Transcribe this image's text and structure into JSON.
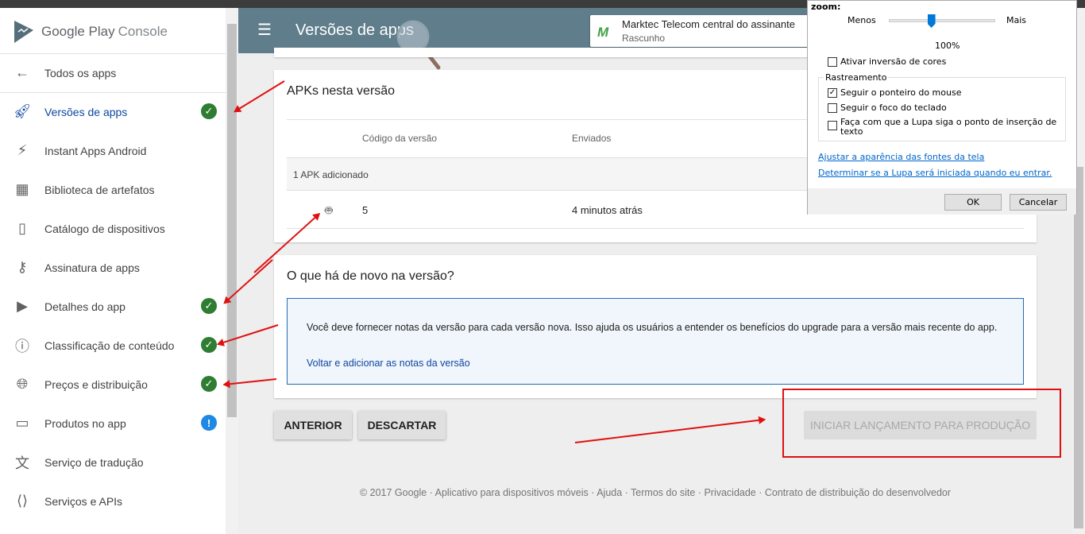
{
  "sidebar": {
    "logo": "Google Play",
    "logo_suffix": "Console",
    "items": [
      {
        "label": "Todos os apps",
        "icon": "arrow-left-icon"
      },
      {
        "label": "Versões de apps",
        "icon": "rocket-icon",
        "status": "check"
      },
      {
        "label": "Instant Apps Android",
        "icon": "bolt-icon"
      },
      {
        "label": "Biblioteca de artefatos",
        "icon": "library-icon"
      },
      {
        "label": "Catálogo de dispositivos",
        "icon": "device-icon"
      },
      {
        "label": "Assinatura de apps",
        "icon": "key-icon"
      },
      {
        "label": "Detalhes do app",
        "icon": "store-icon",
        "status": "check"
      },
      {
        "label": "Classificação de conteúdo",
        "icon": "rating-icon",
        "status": "check"
      },
      {
        "label": "Preços e distribuição",
        "icon": "globe-icon",
        "status": "check"
      },
      {
        "label": "Produtos no app",
        "icon": "card-icon",
        "status": "warning"
      },
      {
        "label": "Serviço de tradução",
        "icon": "translate-icon"
      },
      {
        "label": "Serviços e APIs",
        "icon": "api-icon"
      }
    ]
  },
  "header": {
    "title": "Versões de apps",
    "app_name": "Marktec Telecom central do assinante",
    "app_status": "Rascunho"
  },
  "apks": {
    "title": "APKs nesta versão",
    "col_code": "Código da versão",
    "col_sent": "Enviados",
    "group": "1 APK adicionado",
    "rows": [
      {
        "code": "5",
        "sent": "4 minutos atrás"
      }
    ]
  },
  "whatsnew": {
    "title": "O que há de novo na versão?",
    "message": "Você deve fornecer notas da versão para cada versão nova. Isso ajuda os usuários a entender os benefícios do upgrade para a versão mais recente do app.",
    "link": "Voltar e adicionar as notas da versão"
  },
  "actions": {
    "previous": "ANTERIOR",
    "discard": "DESCARTAR",
    "launch": "INICIAR LANÇAMENTO PARA PRODUÇÃO"
  },
  "footer": "© 2017 Google · Aplicativo para dispositivos móveis · Ajuda · Termos do site · Privacidade · Contrato de distribuição do desenvolvedor",
  "magnifier": {
    "title": "zoom:",
    "less": "Menos",
    "more": "Mais",
    "zoom_value": "100%",
    "zoom_percent": 100,
    "invert": "Ativar inversão de cores",
    "invert_checked": false,
    "tracking_title": "Rastreamento",
    "follow_mouse": "Seguir o ponteiro do mouse",
    "follow_mouse_checked": true,
    "follow_keyboard": "Seguir o foco do teclado",
    "follow_keyboard_checked": false,
    "follow_text": "Faça com que a Lupa siga o ponto de inserção de texto",
    "follow_text_checked": false,
    "link_fonts": "Ajustar a aparência das fontes da tela",
    "link_startup": "Determinar se a Lupa será iniciada quando eu entrar.",
    "ok": "OK",
    "cancel": "Cancelar"
  },
  "colors": {
    "header": "#607d8b",
    "accent": "#0d47a1",
    "check": "#2e7d32",
    "warning": "#1e88e5",
    "annotation": "#e01010"
  }
}
